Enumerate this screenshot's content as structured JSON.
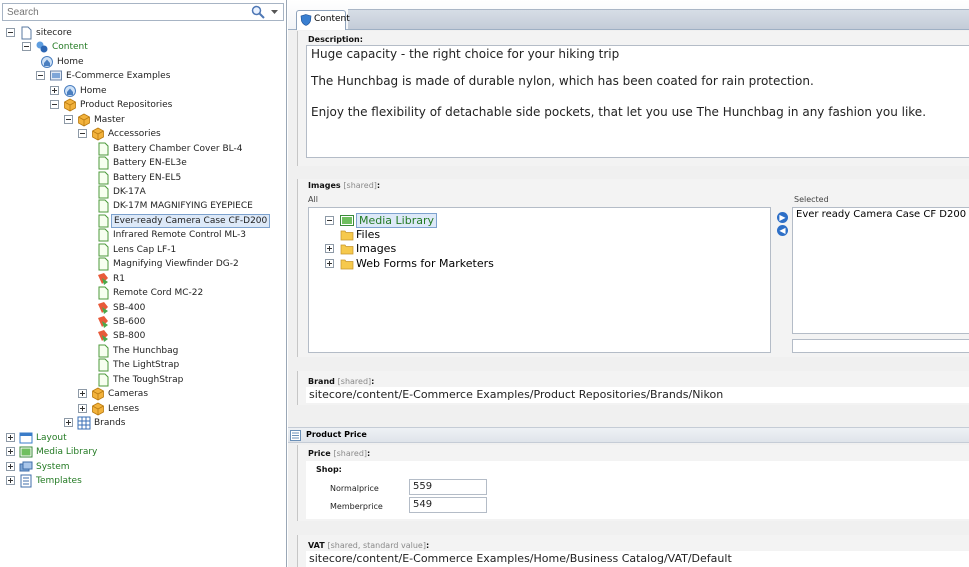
{
  "search": {
    "placeholder": "Search"
  },
  "tree": {
    "items": [
      {
        "label": "sitecore"
      },
      {
        "label": "Content"
      },
      {
        "label": "Home"
      },
      {
        "label": "E-Commerce Examples"
      },
      {
        "label": "Home"
      },
      {
        "label": "Product Repositories"
      },
      {
        "label": "Master"
      },
      {
        "label": "Accessories"
      },
      {
        "label": "Battery Chamber Cover BL-4"
      },
      {
        "label": "Battery EN-EL3e"
      },
      {
        "label": "Battery EN-EL5"
      },
      {
        "label": "DK-17A"
      },
      {
        "label": "DK-17M MAGNIFYING EYEPIECE"
      },
      {
        "label": "Ever-ready Camera Case CF-D200"
      },
      {
        "label": "Infrared Remote Control ML-3"
      },
      {
        "label": "Lens Cap LF-1"
      },
      {
        "label": "Magnifying Viewfinder DG-2"
      },
      {
        "label": "R1"
      },
      {
        "label": "Remote Cord MC-22"
      },
      {
        "label": "SB-400"
      },
      {
        "label": "SB-600"
      },
      {
        "label": "SB-800"
      },
      {
        "label": "The Hunchbag"
      },
      {
        "label": "The LightStrap"
      },
      {
        "label": "The ToughStrap"
      },
      {
        "label": "Cameras"
      },
      {
        "label": "Lenses"
      },
      {
        "label": "Brands"
      },
      {
        "label": "Layout"
      },
      {
        "label": "Media Library"
      },
      {
        "label": "System"
      },
      {
        "label": "Templates"
      }
    ]
  },
  "tabs": {
    "content_label": "Content"
  },
  "description": {
    "label": "Description:",
    "lines": [
      "Huge capacity - the right choice for your hiking trip",
      "The Hunchbag is made of durable nylon, which has been coated for rain protection.",
      "Enjoy the flexibility of detachable side pockets, that let you use The Hunchbag in any fashion you like."
    ]
  },
  "images": {
    "label": "Images",
    "meta": "[shared]",
    "colon": ":",
    "all_label": "All",
    "selected_label": "Selected",
    "tree": [
      {
        "label": "Media Library"
      },
      {
        "label": "Files"
      },
      {
        "label": "Images"
      },
      {
        "label": "Web Forms for Marketers"
      }
    ],
    "selected_items": [
      "Ever ready Camera Case CF D200"
    ]
  },
  "brand": {
    "label": "Brand",
    "meta": "[shared]",
    "colon": ":",
    "value": "sitecore/content/E-Commerce Examples/Product Repositories/Brands/Nikon"
  },
  "product_price": {
    "header": "Product Price",
    "price_label": "Price",
    "price_meta": "[shared]",
    "colon": ":",
    "shop_label": "Shop:",
    "normalprice_label": "Normalprice",
    "normalprice_value": "559",
    "memberprice_label": "Memberprice",
    "memberprice_value": "549"
  },
  "vat": {
    "label": "VAT",
    "meta": "[shared, standard value]",
    "colon": ":",
    "value": "sitecore/content/E-Commerce Examples/Home/Business Catalog/VAT/Default"
  },
  "colors": {
    "green_label": "#237a23",
    "selection_bg": "#dde9f8",
    "panel_bg": "#f3f3f3"
  }
}
